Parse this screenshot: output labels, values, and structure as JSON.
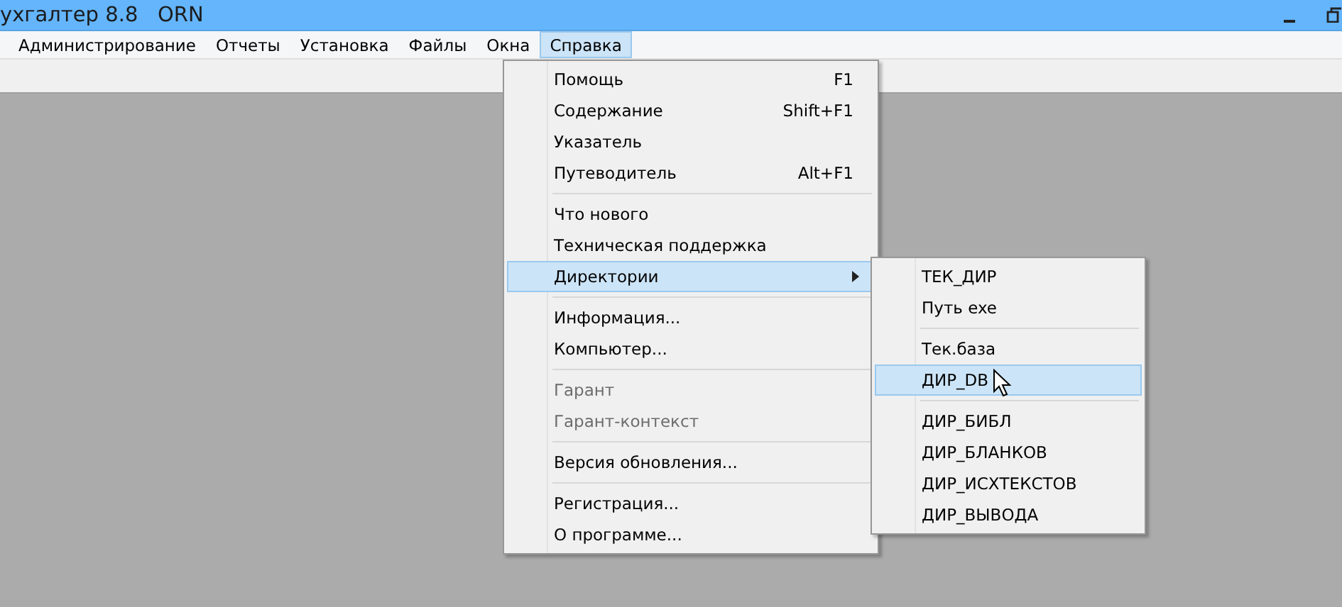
{
  "window": {
    "title": "ухгалтер 8.8   ORN"
  },
  "menubar": [
    {
      "label": "Администрирование",
      "selected": false
    },
    {
      "label": "Отчеты",
      "selected": false
    },
    {
      "label": "Установка",
      "selected": false
    },
    {
      "label": "Файлы",
      "selected": false
    },
    {
      "label": "Окна",
      "selected": false
    },
    {
      "label": "Справка",
      "selected": true
    }
  ],
  "menu": {
    "items": [
      {
        "kind": "item",
        "label": "Помощь",
        "shortcut": "F1",
        "disabled": false,
        "selected": false,
        "submenu": false
      },
      {
        "kind": "item",
        "label": "Содержание",
        "shortcut": "Shift+F1",
        "disabled": false,
        "selected": false,
        "submenu": false
      },
      {
        "kind": "item",
        "label": "Указатель",
        "disabled": false,
        "selected": false,
        "submenu": false
      },
      {
        "kind": "item",
        "label": "Путеводитель",
        "shortcut": "Alt+F1",
        "disabled": false,
        "selected": false,
        "submenu": false
      },
      {
        "kind": "separator"
      },
      {
        "kind": "item",
        "label": "Что нового",
        "disabled": false,
        "selected": false,
        "submenu": false
      },
      {
        "kind": "item",
        "label": "Техническая поддержка",
        "disabled": false,
        "selected": false,
        "submenu": false
      },
      {
        "kind": "item",
        "label": "Директории",
        "disabled": false,
        "selected": true,
        "submenu": true
      },
      {
        "kind": "separator"
      },
      {
        "kind": "item",
        "label": "Информация...",
        "disabled": false,
        "selected": false,
        "submenu": false
      },
      {
        "kind": "item",
        "label": "Компьютер...",
        "disabled": false,
        "selected": false,
        "submenu": false
      },
      {
        "kind": "separator"
      },
      {
        "kind": "item",
        "label": "Гарант",
        "disabled": true,
        "selected": false,
        "submenu": false
      },
      {
        "kind": "item",
        "label": "Гарант-контекст",
        "disabled": true,
        "selected": false,
        "submenu": false
      },
      {
        "kind": "separator"
      },
      {
        "kind": "item",
        "label": "Версия обновления...",
        "disabled": false,
        "selected": false,
        "submenu": false
      },
      {
        "kind": "separator"
      },
      {
        "kind": "item",
        "label": "Регистрация...",
        "disabled": false,
        "selected": false,
        "submenu": false
      },
      {
        "kind": "item",
        "label": "О программе...",
        "disabled": false,
        "selected": false,
        "submenu": false
      }
    ]
  },
  "submenu": {
    "items": [
      {
        "kind": "item",
        "label": "ТЕК_ДИР",
        "selected": false
      },
      {
        "kind": "item",
        "label": "Путь exe",
        "selected": false
      },
      {
        "kind": "separator"
      },
      {
        "kind": "item",
        "label": "Тек.база",
        "selected": false
      },
      {
        "kind": "item",
        "label": "ДИР_DB",
        "selected": true
      },
      {
        "kind": "separator"
      },
      {
        "kind": "item",
        "label": "ДИР_БИБЛ",
        "selected": false
      },
      {
        "kind": "item",
        "label": "ДИР_БЛАНКОВ",
        "selected": false
      },
      {
        "kind": "item",
        "label": "ДИР_ИСХТЕКСТОВ",
        "selected": false
      },
      {
        "kind": "item",
        "label": "ДИР_ВЫВОДА",
        "selected": false
      }
    ]
  }
}
